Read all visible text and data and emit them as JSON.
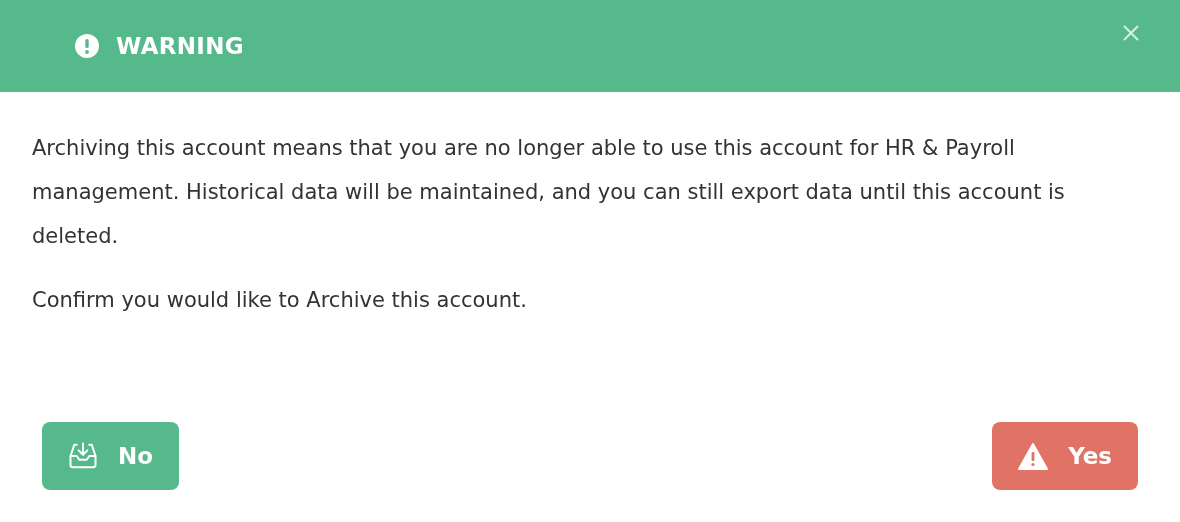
{
  "dialog": {
    "title": "WARNING",
    "paragraphs": [
      "Archiving this account means that you are no longer able to use this account for HR & Payroll management. Historical data will be maintained, and you can still export data until this account is deleted.",
      "Confirm you would like to Archive this account."
    ],
    "buttons": [
      {
        "label": "No",
        "kind": "cancel"
      },
      {
        "label": "Yes",
        "kind": "confirm"
      }
    ]
  }
}
